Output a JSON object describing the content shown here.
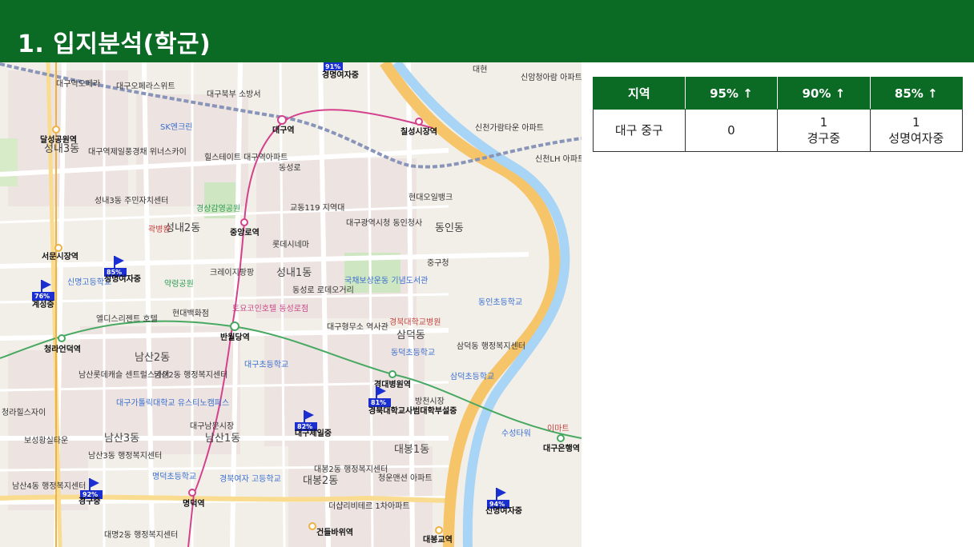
{
  "title": "1. 입지분석(학군)",
  "table": {
    "headers": [
      "지역",
      "95% ↑",
      "90% ↑",
      "85% ↑"
    ],
    "row": {
      "region": "대구 중구",
      "c95": "0",
      "c90_count": "1",
      "c90_school": "경구중",
      "c85_count": "1",
      "c85_school": "성명여자중"
    }
  },
  "map": {
    "school_flags": [
      {
        "pct": "91%",
        "name": "경명여자중"
      },
      {
        "pct": "85%",
        "name": "성명여자중"
      },
      {
        "pct": "76%",
        "name": "계성중"
      },
      {
        "pct": "81%",
        "name": "경북대학교사범대학부설중"
      },
      {
        "pct": "82%",
        "name": "대구제일중"
      },
      {
        "pct": "92%",
        "name": "경구중"
      },
      {
        "pct": "94%",
        "name": "신명여자중"
      }
    ],
    "stations": [
      "대구역",
      "칠성시장역",
      "중앙로역",
      "반월당역",
      "서문시장역",
      "청라언덕역",
      "경대병원역",
      "명덕역",
      "건들바위역",
      "대봉교역",
      "대구은행역",
      "달성공원역"
    ],
    "districts": [
      "성내3동",
      "성내1동",
      "동인동",
      "남산2동",
      "삼덕동",
      "남산1동",
      "남산3동",
      "대봉1동",
      "대봉2동",
      "성내2동"
    ],
    "places": [
      "동성로",
      "대구역오페라",
      "대구오페라스위트",
      "SK엔크린",
      "대구역제일풍경채 위너스카이",
      "힐스테이트 대구역아파트",
      "성내3동 주민자치센터",
      "경상감영공원",
      "곽병원",
      "교동119 지역대",
      "대구광역시청 동인청사",
      "현대오일뱅크",
      "롯데시네마",
      "크레이지팡팡",
      "약령공원",
      "토요코인호텔 동성로점",
      "동성로 로데오거리",
      "국채보상운동 기념도서관",
      "중구청",
      "동인초등학교",
      "현대백화점",
      "엘디스리젠트 호텔",
      "대구형무소 역사관",
      "경북대학교병원",
      "삼덕동 행정복지센터",
      "동덕초등학교",
      "대구초등학교",
      "남산2동 행정복지센터",
      "남산롯데캐슬 센트럴스카이",
      "대구가톨릭대학교 유스티노캠퍼스",
      "대구남문시장",
      "방천시장",
      "삼덕초등학교",
      "수성타워",
      "이마트",
      "남산3동 행정복지센터",
      "보성황실타운",
      "명덕초등학교",
      "경북여자 고등학교",
      "대봉2동 행정복지센터",
      "청운맨션 아파트",
      "더샵리비테르 1차아파트",
      "신천가람타운 아파트",
      "신천LH 아파트",
      "신암청아람 아파트",
      "대구북부 소방서",
      "남산4동 행정복지센터",
      "대명2동 행정복지센터",
      "신명고등학교",
      "청라힐스자이",
      "대현"
    ]
  },
  "colors": {
    "brand": "#0b6a24",
    "flag": "#1b2fd1",
    "river": "#a8d4f5",
    "highway": "#f6c469"
  }
}
